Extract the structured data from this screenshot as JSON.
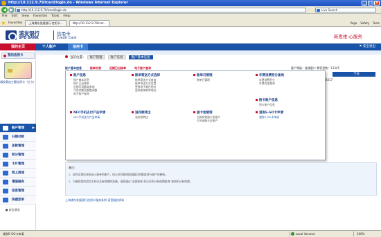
{
  "browser": {
    "title": "http://10.112.9.79/icard/login.do - Windows Internet Explorer",
    "address": "http://10.112.9.79/icard/login.do",
    "search_placeholder": "Live Search",
    "menu": [
      "File",
      "Edit",
      "View",
      "Favorites",
      "Tools",
      "Help"
    ],
    "favorites_label": "Favorites",
    "tabs": [
      "上海浦东发展银行-信用卡...",
      "http://10.112.9.79/icar..."
    ],
    "commands": [
      "Page",
      "Safety",
      "Tools"
    ],
    "status_text": "浦发E-GO卡申请",
    "status_zone": "Local intranet",
    "zoom": "100%"
  },
  "header": {
    "bank_cn": "浦发银行",
    "bank_en": "SPD BANK",
    "card_cn": "信用卡",
    "card_en": "Credit Card",
    "slogan": "新思维·心服务"
  },
  "nav": {
    "home": "我的主页",
    "items": [
      "个人账户",
      "信用卡"
    ],
    "logout": "安全退出"
  },
  "sidebar": {
    "my_card": "我的信用卡",
    "card_caption": "浦发奥迪主题信用卡（主卡）",
    "items": [
      "账户管理",
      "分期付款",
      "还款管理",
      "积分管理",
      "卡片管理",
      "网上商城",
      "增值服务",
      "信息管理",
      "快捷菜单"
    ],
    "safe_exit": "安全退出"
  },
  "breadcrumb": {
    "prefix": "当前位置：",
    "parts": [
      "账户管理",
      "账户信息",
      "账户基本信息"
    ]
  },
  "tabs": [
    "账户基本信息",
    "账单交易",
    "近期已出账单",
    "电子账户查询"
  ],
  "customer": {
    "info": "客户等级：普通客户  累积里数：11345",
    "strip": "卡号",
    "card_no": "****8317"
  },
  "menu_panel": {
    "columns": [
      {
        "title": "账户信息",
        "items": [
          "账户基本信息",
          "账户已出账单",
          "近期可用额度查询",
          "可用余额及额度调整",
          "电子账户查询"
        ]
      },
      {
        "title": "账单寄送方式选择",
        "items": [
          "账单寄送方式查询",
          "账单寄送方式设置",
          "更改电子邮件地址",
          "更改账单邮寄地址"
        ]
      },
      {
        "title": "账单日管理",
        "items": [
          "账单日管理"
        ]
      },
      {
        "title": "年费消费积分查询",
        "items": [
          "年费消费积分",
          "年费优惠查询"
        ]
      },
      {
        "title": "附卡账户信息",
        "items": [
          "附卡账户信息"
        ]
      },
      {
        "title": "NFC手机支付产品申请",
        "items": [
          "NFC手机支付产品申请"
        ]
      },
      {
        "title": "溢存款转出",
        "items": [
          "溢存款转出"
        ]
      },
      {
        "title": "副卡金管理",
        "items": [
          "当前有效副卡金账户",
          "已关闭副卡金账户"
        ]
      },
      {
        "title": "浦发E-GO卡申请",
        "items": [
          "浦发E-GO卡申请"
        ]
      }
    ]
  },
  "notes": {
    "title": "备注：",
    "lines": [
      "1、因为近期交易未纳入账单的账户，所以则可能按照调整后的额度进行账户的更新。",
      "2、为确保您的信用卡积分及有效期的准确，请您通过“全部账单-积分及积分有效期查询”查询积分有效期。"
    ]
  },
  "bottom_link": "上海浦东发展银行信用卡服务条例  语音服务资料"
}
